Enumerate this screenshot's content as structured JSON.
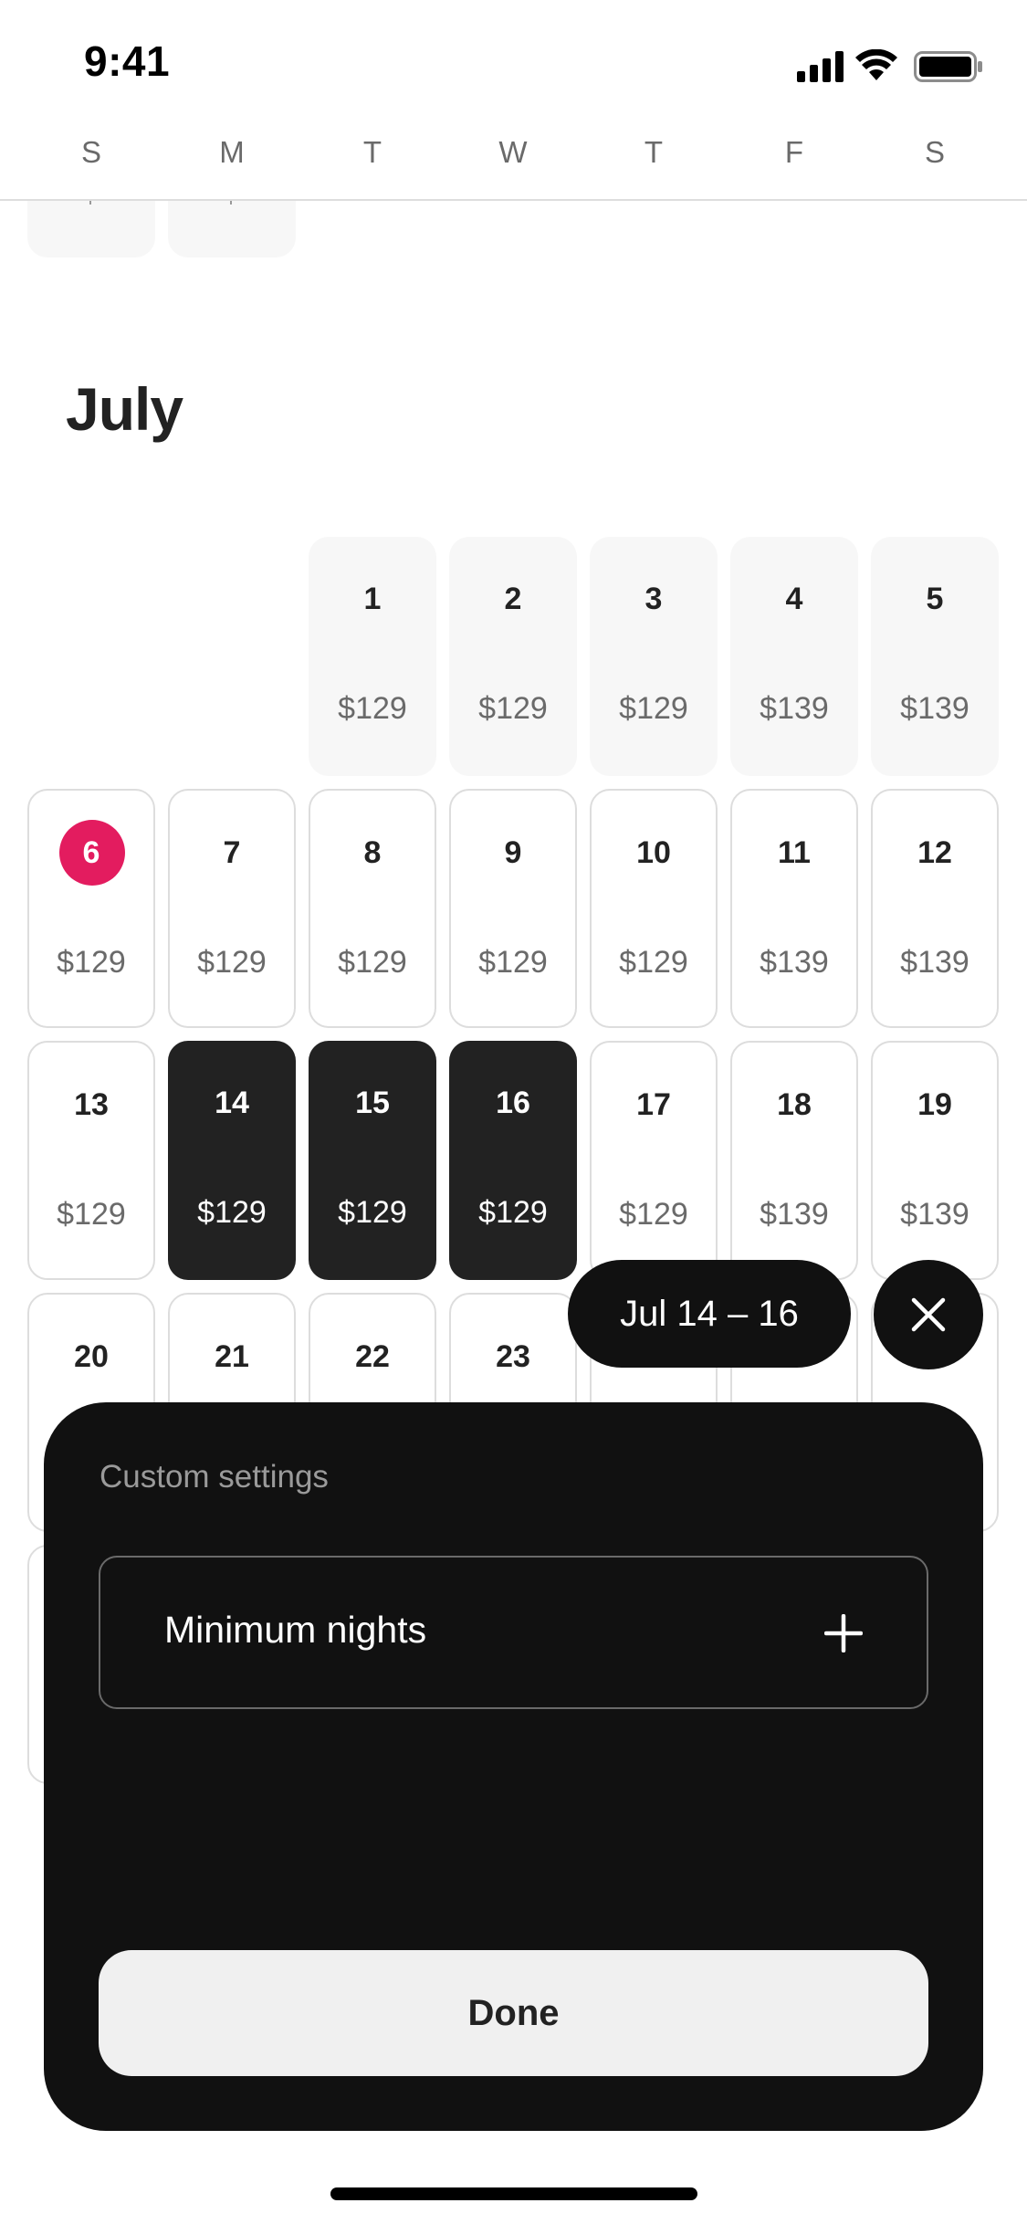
{
  "status_bar": {
    "time": "9:41"
  },
  "weekdays": [
    "S",
    "M",
    "T",
    "W",
    "T",
    "F",
    "S"
  ],
  "calendar": {
    "month": "July",
    "rows": [
      [
        null,
        null,
        {
          "day": "1",
          "price": "$129",
          "state": "past"
        },
        {
          "day": "2",
          "price": "$129",
          "state": "past"
        },
        {
          "day": "3",
          "price": "$129",
          "state": "past"
        },
        {
          "day": "4",
          "price": "$139",
          "state": "past"
        },
        {
          "day": "5",
          "price": "$139",
          "state": "past"
        }
      ],
      [
        {
          "day": "6",
          "price": "$129",
          "state": "today"
        },
        {
          "day": "7",
          "price": "$129",
          "state": "avail"
        },
        {
          "day": "8",
          "price": "$129",
          "state": "avail"
        },
        {
          "day": "9",
          "price": "$129",
          "state": "avail"
        },
        {
          "day": "10",
          "price": "$129",
          "state": "avail"
        },
        {
          "day": "11",
          "price": "$139",
          "state": "avail"
        },
        {
          "day": "12",
          "price": "$139",
          "state": "avail"
        }
      ],
      [
        {
          "day": "13",
          "price": "$129",
          "state": "avail"
        },
        {
          "day": "14",
          "price": "$129",
          "state": "selected"
        },
        {
          "day": "15",
          "price": "$129",
          "state": "selected"
        },
        {
          "day": "16",
          "price": "$129",
          "state": "selected"
        },
        {
          "day": "17",
          "price": "$129",
          "state": "avail"
        },
        {
          "day": "18",
          "price": "$139",
          "state": "avail"
        },
        {
          "day": "19",
          "price": "$139",
          "state": "avail"
        }
      ],
      [
        {
          "day": "20",
          "price": "",
          "state": "avail"
        },
        {
          "day": "21",
          "price": "",
          "state": "avail"
        },
        {
          "day": "22",
          "price": "",
          "state": "avail"
        },
        {
          "day": "23",
          "price": "",
          "state": "avail"
        },
        {
          "day": "",
          "price": "",
          "state": "avail"
        },
        {
          "day": "",
          "price": "",
          "state": "avail"
        },
        {
          "day": "",
          "price": "",
          "state": "avail"
        }
      ],
      [
        {
          "day": "",
          "price": "",
          "state": "avail"
        },
        null,
        null,
        null,
        null,
        null,
        null
      ]
    ]
  },
  "selection": {
    "range_label": "Jul 14 – 16"
  },
  "sheet": {
    "title": "Custom settings",
    "minimum_nights_label": "Minimum nights",
    "done_label": "Done"
  },
  "colors": {
    "today": "#e31c5f",
    "selected": "#222222",
    "sheet_bg": "#111111"
  },
  "icons": {
    "close": "close-icon",
    "plus": "plus-icon",
    "signal": "cellular-signal-icon",
    "wifi": "wifi-icon",
    "battery": "battery-icon"
  }
}
